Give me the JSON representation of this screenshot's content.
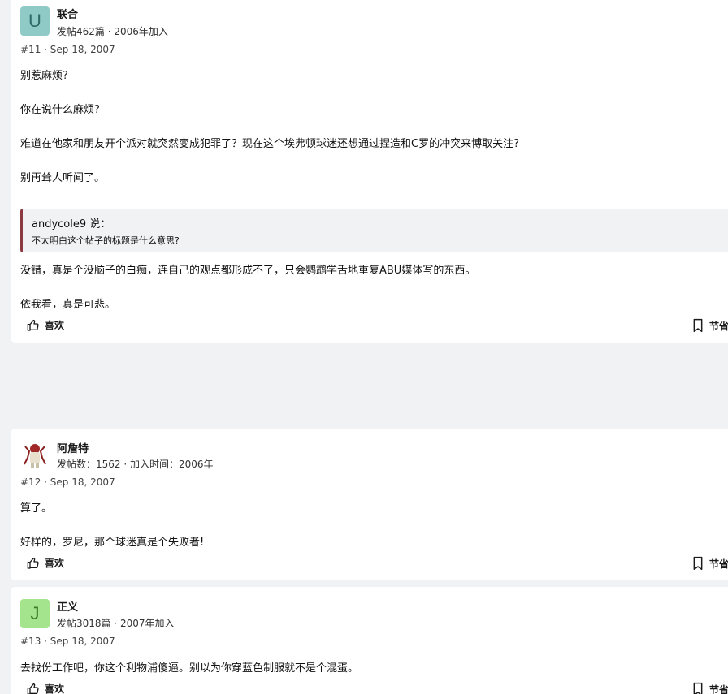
{
  "posts": [
    {
      "author": "联合",
      "avatar_letter": "U",
      "meta": "发帖462篇 · 2006年加入",
      "post_number": "#11 · Sep 18, 2007",
      "paragraphs": [
        "别惹麻烦?",
        "你在说什么麻烦?",
        "难道在他家和朋友开个派对就突然变成犯罪了？现在这个埃弗顿球迷还想通过捏造和C罗的冲突来博取关注?",
        "别再耸人听闻了。"
      ],
      "quote": {
        "author": "andycole9 说：",
        "text": "不太明白这个帖子的标题是什么意思?"
      },
      "after_quote": [
        "没错，真是个没脑子的白痴，连自己的观点都形成不了，只会鹦鹉学舌地重复ABU媒体写的东西。",
        "依我看，真是可悲。"
      ],
      "like_label": "喜欢",
      "save_label": "节省"
    },
    {
      "author": "阿詹特",
      "meta": "发帖数：1562 · 加入时间：2006年",
      "post_number": "#12 · Sep 18, 2007",
      "paragraphs": [
        "算了。",
        "好样的，罗尼，那个球迷真是个失败者!"
      ],
      "like_label": "喜欢",
      "save_label": "节省"
    },
    {
      "author": "正义",
      "avatar_letter": "J",
      "meta": "发帖3018篇 · 2007年加入",
      "post_number": "#13 · Sep 18, 2007",
      "paragraphs": [
        "去找份工作吧，你这个利物浦傻逼。别以为你穿蓝色制服就不是个混蛋。"
      ],
      "like_label": "喜欢",
      "save_label": "节省"
    }
  ],
  "icons": {
    "like": "thumbs-up-icon",
    "save": "bookmark-icon"
  },
  "colors": {
    "page_bg": "#f1f2f4",
    "avatar_u": "#8fcac6",
    "avatar_j": "#a3e48c",
    "quote_border": "#8c3a40"
  }
}
